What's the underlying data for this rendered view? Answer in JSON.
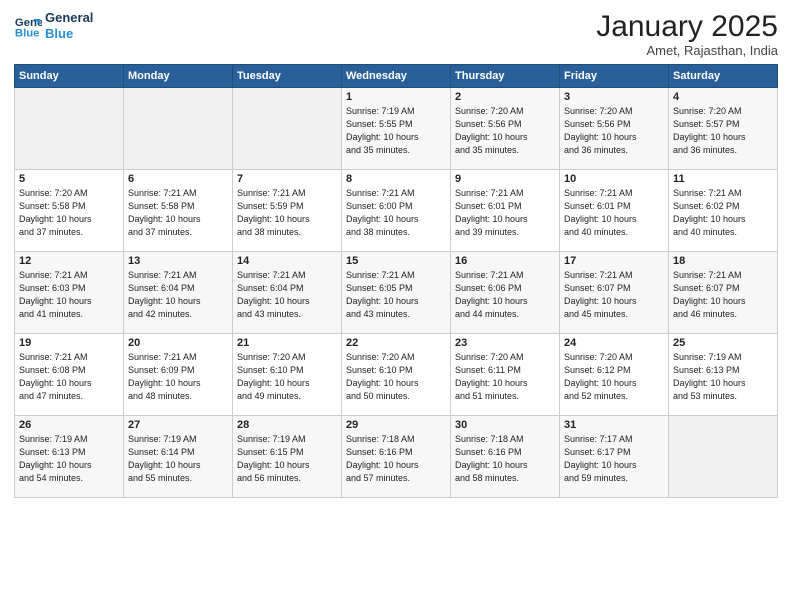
{
  "header": {
    "logo_line1": "General",
    "logo_line2": "Blue",
    "title": "January 2025",
    "location": "Amet, Rajasthan, India"
  },
  "days_of_week": [
    "Sunday",
    "Monday",
    "Tuesday",
    "Wednesday",
    "Thursday",
    "Friday",
    "Saturday"
  ],
  "weeks": [
    [
      {
        "day": "",
        "info": ""
      },
      {
        "day": "",
        "info": ""
      },
      {
        "day": "",
        "info": ""
      },
      {
        "day": "1",
        "info": "Sunrise: 7:19 AM\nSunset: 5:55 PM\nDaylight: 10 hours\nand 35 minutes."
      },
      {
        "day": "2",
        "info": "Sunrise: 7:20 AM\nSunset: 5:56 PM\nDaylight: 10 hours\nand 35 minutes."
      },
      {
        "day": "3",
        "info": "Sunrise: 7:20 AM\nSunset: 5:56 PM\nDaylight: 10 hours\nand 36 minutes."
      },
      {
        "day": "4",
        "info": "Sunrise: 7:20 AM\nSunset: 5:57 PM\nDaylight: 10 hours\nand 36 minutes."
      }
    ],
    [
      {
        "day": "5",
        "info": "Sunrise: 7:20 AM\nSunset: 5:58 PM\nDaylight: 10 hours\nand 37 minutes."
      },
      {
        "day": "6",
        "info": "Sunrise: 7:21 AM\nSunset: 5:58 PM\nDaylight: 10 hours\nand 37 minutes."
      },
      {
        "day": "7",
        "info": "Sunrise: 7:21 AM\nSunset: 5:59 PM\nDaylight: 10 hours\nand 38 minutes."
      },
      {
        "day": "8",
        "info": "Sunrise: 7:21 AM\nSunset: 6:00 PM\nDaylight: 10 hours\nand 38 minutes."
      },
      {
        "day": "9",
        "info": "Sunrise: 7:21 AM\nSunset: 6:01 PM\nDaylight: 10 hours\nand 39 minutes."
      },
      {
        "day": "10",
        "info": "Sunrise: 7:21 AM\nSunset: 6:01 PM\nDaylight: 10 hours\nand 40 minutes."
      },
      {
        "day": "11",
        "info": "Sunrise: 7:21 AM\nSunset: 6:02 PM\nDaylight: 10 hours\nand 40 minutes."
      }
    ],
    [
      {
        "day": "12",
        "info": "Sunrise: 7:21 AM\nSunset: 6:03 PM\nDaylight: 10 hours\nand 41 minutes."
      },
      {
        "day": "13",
        "info": "Sunrise: 7:21 AM\nSunset: 6:04 PM\nDaylight: 10 hours\nand 42 minutes."
      },
      {
        "day": "14",
        "info": "Sunrise: 7:21 AM\nSunset: 6:04 PM\nDaylight: 10 hours\nand 43 minutes."
      },
      {
        "day": "15",
        "info": "Sunrise: 7:21 AM\nSunset: 6:05 PM\nDaylight: 10 hours\nand 43 minutes."
      },
      {
        "day": "16",
        "info": "Sunrise: 7:21 AM\nSunset: 6:06 PM\nDaylight: 10 hours\nand 44 minutes."
      },
      {
        "day": "17",
        "info": "Sunrise: 7:21 AM\nSunset: 6:07 PM\nDaylight: 10 hours\nand 45 minutes."
      },
      {
        "day": "18",
        "info": "Sunrise: 7:21 AM\nSunset: 6:07 PM\nDaylight: 10 hours\nand 46 minutes."
      }
    ],
    [
      {
        "day": "19",
        "info": "Sunrise: 7:21 AM\nSunset: 6:08 PM\nDaylight: 10 hours\nand 47 minutes."
      },
      {
        "day": "20",
        "info": "Sunrise: 7:21 AM\nSunset: 6:09 PM\nDaylight: 10 hours\nand 48 minutes."
      },
      {
        "day": "21",
        "info": "Sunrise: 7:20 AM\nSunset: 6:10 PM\nDaylight: 10 hours\nand 49 minutes."
      },
      {
        "day": "22",
        "info": "Sunrise: 7:20 AM\nSunset: 6:10 PM\nDaylight: 10 hours\nand 50 minutes."
      },
      {
        "day": "23",
        "info": "Sunrise: 7:20 AM\nSunset: 6:11 PM\nDaylight: 10 hours\nand 51 minutes."
      },
      {
        "day": "24",
        "info": "Sunrise: 7:20 AM\nSunset: 6:12 PM\nDaylight: 10 hours\nand 52 minutes."
      },
      {
        "day": "25",
        "info": "Sunrise: 7:19 AM\nSunset: 6:13 PM\nDaylight: 10 hours\nand 53 minutes."
      }
    ],
    [
      {
        "day": "26",
        "info": "Sunrise: 7:19 AM\nSunset: 6:13 PM\nDaylight: 10 hours\nand 54 minutes."
      },
      {
        "day": "27",
        "info": "Sunrise: 7:19 AM\nSunset: 6:14 PM\nDaylight: 10 hours\nand 55 minutes."
      },
      {
        "day": "28",
        "info": "Sunrise: 7:19 AM\nSunset: 6:15 PM\nDaylight: 10 hours\nand 56 minutes."
      },
      {
        "day": "29",
        "info": "Sunrise: 7:18 AM\nSunset: 6:16 PM\nDaylight: 10 hours\nand 57 minutes."
      },
      {
        "day": "30",
        "info": "Sunrise: 7:18 AM\nSunset: 6:16 PM\nDaylight: 10 hours\nand 58 minutes."
      },
      {
        "day": "31",
        "info": "Sunrise: 7:17 AM\nSunset: 6:17 PM\nDaylight: 10 hours\nand 59 minutes."
      },
      {
        "day": "",
        "info": ""
      }
    ]
  ]
}
